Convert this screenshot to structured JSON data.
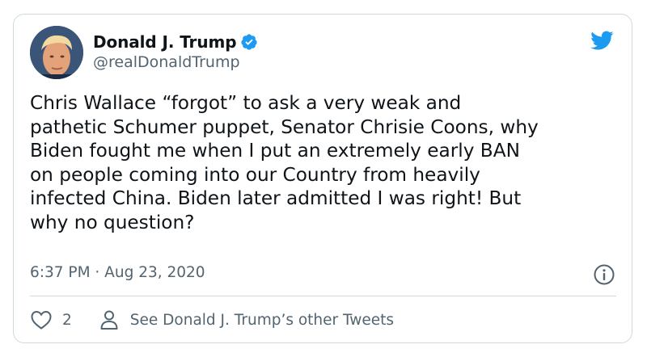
{
  "author": {
    "name": "Donald J. Trump",
    "handle": "@realDonaldTrump",
    "verified": true
  },
  "tweet": {
    "text": "Chris Wallace “forgot” to ask a very weak and\npathetic Schumer puppet, Senator Chrisie Coons, why\nBiden fought me when I put an extremely early BAN\non people coming into our Country from heavily\ninfected China. Biden later admitted I was right! But\nwhy no question?",
    "timestamp": "6:37 PM · Aug 23, 2020"
  },
  "actions": {
    "like_count": "2",
    "profile_link": "See Donald J. Trump’s other Tweets"
  },
  "icons": {
    "brand": "twitter-bird-icon",
    "verified": "verified-badge-icon",
    "info": "info-icon",
    "like": "heart-icon",
    "profile": "person-icon"
  },
  "colors": {
    "brand_blue": "#1d9bf0",
    "text_primary": "#0f1419",
    "text_secondary": "#536471",
    "border": "#cfd9de"
  }
}
